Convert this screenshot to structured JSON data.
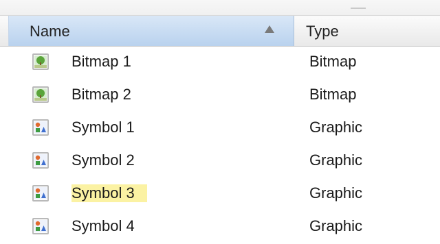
{
  "header": {
    "name_label": "Name",
    "type_label": "Type"
  },
  "rows": [
    {
      "name": "Bitmap 1",
      "type": "Bitmap",
      "icon": "bitmap-icon",
      "highlight": false
    },
    {
      "name": "Bitmap 2",
      "type": "Bitmap",
      "icon": "bitmap-icon",
      "highlight": false
    },
    {
      "name": "Symbol 1",
      "type": "Graphic",
      "icon": "graphic-symbol-icon",
      "highlight": false
    },
    {
      "name": "Symbol 2",
      "type": "Graphic",
      "icon": "graphic-symbol-icon",
      "highlight": false
    },
    {
      "name": "Symbol 3",
      "type": "Graphic",
      "icon": "graphic-symbol-icon",
      "highlight": true
    },
    {
      "name": "Symbol 4",
      "type": "Graphic",
      "icon": "graphic-symbol-icon",
      "highlight": false
    }
  ],
  "colors": {
    "header_sorted_bg": "#c7dbf1",
    "highlight": "#fbf2a3"
  }
}
